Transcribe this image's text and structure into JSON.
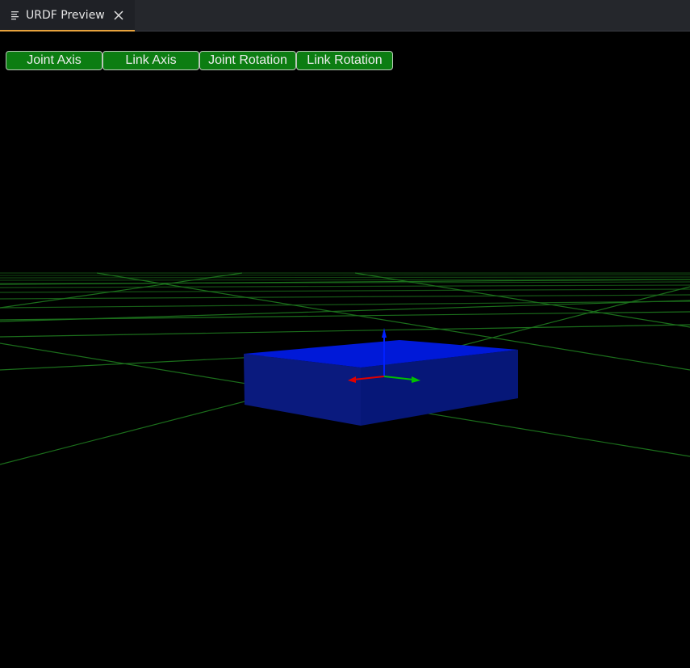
{
  "tab": {
    "title": "URDF Preview",
    "icon": "file-lines-icon",
    "close_icon": "close-icon",
    "accent_color": "#e8a33d"
  },
  "toolbar": {
    "buttons": [
      {
        "label": "Joint Axis"
      },
      {
        "label": "Link Axis"
      },
      {
        "label": "Joint Rotation"
      },
      {
        "label": "Link Rotation"
      }
    ],
    "button_color": "#0c7d12"
  },
  "scene": {
    "background_color": "#000000",
    "grid_color": "#1f8a1f",
    "box_top_color": "#0019d8",
    "box_side_color": "#0a1a7a",
    "axes": {
      "x_color": "#e00000",
      "y_color": "#00c000",
      "z_color": "#0020ff"
    }
  }
}
